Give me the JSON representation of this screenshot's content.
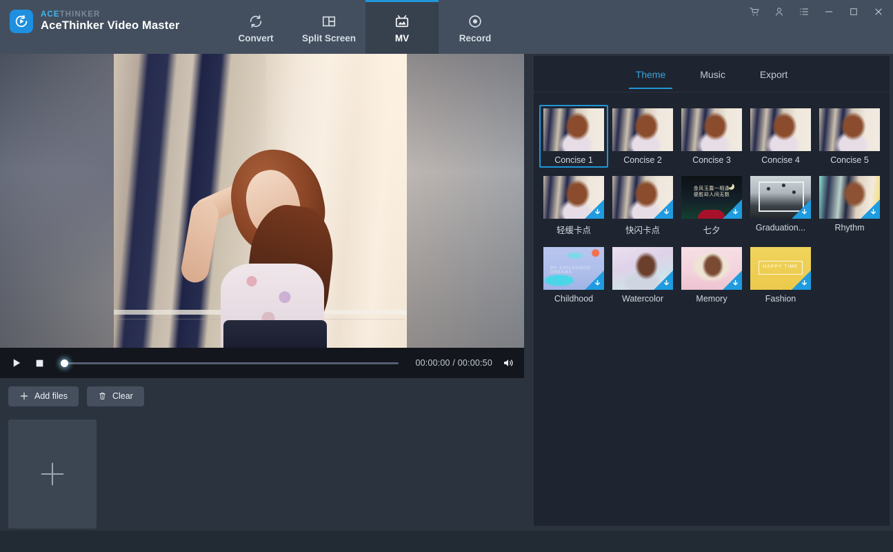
{
  "app": {
    "brand_sup_a": "ACE",
    "brand_sup_b": "THINKER",
    "title": "AceThinker Video Master",
    "accent": "#2196d8"
  },
  "nav": {
    "tabs": [
      {
        "label": "Convert",
        "icon": "refresh-icon",
        "active": false
      },
      {
        "label": "Split Screen",
        "icon": "split-screen-icon",
        "active": false
      },
      {
        "label": "MV",
        "icon": "mv-tv-icon",
        "active": true
      },
      {
        "label": "Record",
        "icon": "record-icon",
        "active": false
      }
    ]
  },
  "window_controls": [
    {
      "name": "cart-icon"
    },
    {
      "name": "account-icon"
    },
    {
      "name": "menu-list-icon"
    },
    {
      "name": "minimize-icon"
    },
    {
      "name": "maximize-icon"
    },
    {
      "name": "close-icon"
    }
  ],
  "player": {
    "play_label": "play-icon",
    "stop_label": "stop-icon",
    "volume_label": "volume-icon",
    "current_time": "00:00:00",
    "total_time": "00:00:50",
    "time_display": "00:00:00 / 00:00:50",
    "progress_percent": 0
  },
  "actions": {
    "add_files_label": "Add files",
    "clear_label": "Clear",
    "add_media_placeholder": "plus-icon"
  },
  "right_panel": {
    "tabs": [
      {
        "label": "Theme",
        "active": true
      },
      {
        "label": "Music",
        "active": false
      },
      {
        "label": "Export",
        "active": false
      }
    ],
    "themes": [
      {
        "label": "Concise 1",
        "art": "th-girl",
        "selected": true,
        "downloadable": false
      },
      {
        "label": "Concise 2",
        "art": "th-girl",
        "selected": false,
        "downloadable": false
      },
      {
        "label": "Concise 3",
        "art": "th-girl",
        "selected": false,
        "downloadable": false
      },
      {
        "label": "Concise 4",
        "art": "th-girl",
        "selected": false,
        "downloadable": false
      },
      {
        "label": "Concise 5",
        "art": "th-girl",
        "selected": false,
        "downloadable": false
      },
      {
        "label": "轻缓卡点",
        "art": "th-girl",
        "selected": false,
        "downloadable": true
      },
      {
        "label": "快闪卡点",
        "art": "th-girl",
        "selected": false,
        "downloadable": true
      },
      {
        "label": "七夕",
        "art": "th-dark",
        "selected": false,
        "downloadable": true,
        "art_text": "金风玉露一相逢\n便胜却人间无数"
      },
      {
        "label": "Graduation...",
        "art": "th-grad",
        "selected": false,
        "downloadable": true
      },
      {
        "label": "Rhythm",
        "art": "th-rhythm",
        "selected": false,
        "downloadable": true
      },
      {
        "label": "Childhood",
        "art": "th-child",
        "selected": false,
        "downloadable": true,
        "art_text": "MY CHILDHOOD DREAMS"
      },
      {
        "label": "Watercolor",
        "art": "th-water",
        "selected": false,
        "downloadable": true
      },
      {
        "label": "Memory",
        "art": "th-mem",
        "selected": false,
        "downloadable": true
      },
      {
        "label": "Fashion",
        "art": "th-fash",
        "selected": false,
        "downloadable": true,
        "art_text": "HAPPY TIME"
      }
    ]
  }
}
